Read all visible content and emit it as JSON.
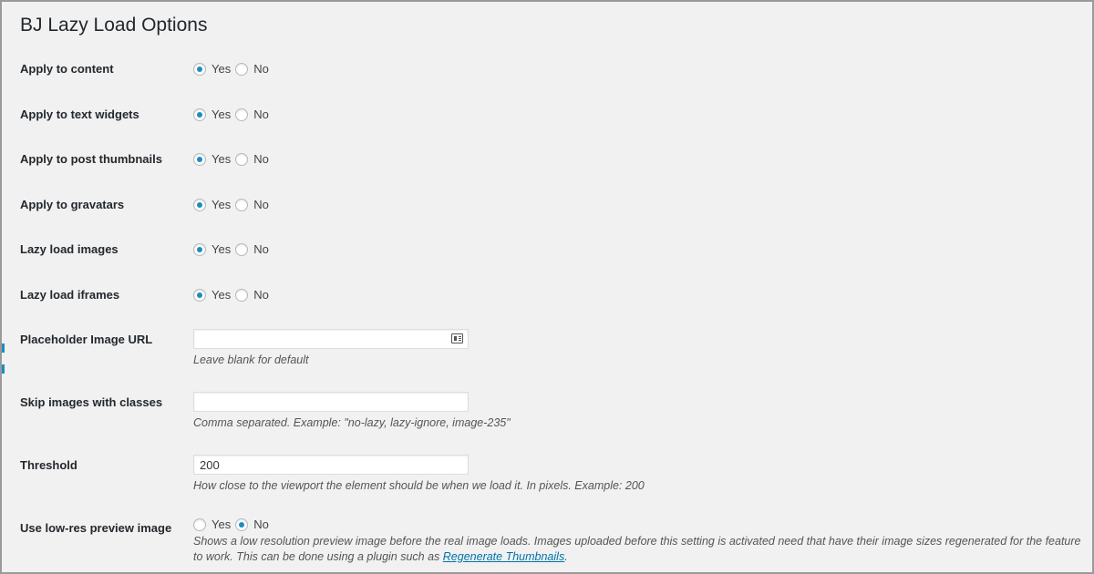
{
  "page": {
    "title": "BJ Lazy Load Options"
  },
  "options": {
    "apply_content": {
      "label": "Apply to content",
      "yes": "Yes",
      "no": "No",
      "selected": "Yes"
    },
    "apply_text_widgets": {
      "label": "Apply to text widgets",
      "yes": "Yes",
      "no": "No",
      "selected": "Yes"
    },
    "apply_post_thumbnails": {
      "label": "Apply to post thumbnails",
      "yes": "Yes",
      "no": "No",
      "selected": "Yes"
    },
    "apply_gravatars": {
      "label": "Apply to gravatars",
      "yes": "Yes",
      "no": "No",
      "selected": "Yes"
    },
    "lazy_load_images": {
      "label": "Lazy load images",
      "yes": "Yes",
      "no": "No",
      "selected": "Yes"
    },
    "lazy_load_iframes": {
      "label": "Lazy load iframes",
      "yes": "Yes",
      "no": "No",
      "selected": "Yes"
    },
    "placeholder_url": {
      "label": "Placeholder Image URL",
      "value": "",
      "description": "Leave blank for default",
      "icon": "media-library-icon"
    },
    "skip_classes": {
      "label": "Skip images with classes",
      "value": "",
      "description": "Comma separated. Example: \"no-lazy, lazy-ignore, image-235\""
    },
    "threshold": {
      "label": "Threshold",
      "value": "200",
      "description": "How close to the viewport the element should be when we load it. In pixels. Example: 200"
    },
    "low_res_preview": {
      "label": "Use low-res preview image",
      "yes": "Yes",
      "no": "No",
      "selected": "No",
      "description": "Shows a low resolution preview image before the real image loads. Images uploaded before this setting is activated need that have their image sizes regenerated for the feature to work. This can be done using a plugin such as ",
      "link_text": "Regenerate Thumbnails",
      "description_end": "."
    }
  },
  "colors": {
    "accent": "#1e8cbe",
    "link": "#0073aa",
    "background": "#f1f1f1"
  }
}
